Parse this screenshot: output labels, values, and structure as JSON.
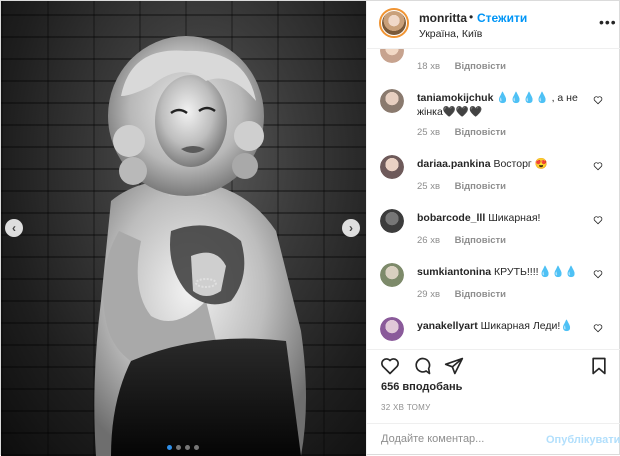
{
  "owner": {
    "username": "monritta",
    "separator": "•",
    "follow_label": "Стежити",
    "location": "Україна, Київ",
    "avatar_icon": "user-avatar-icon",
    "more_icon": "more-options-icon"
  },
  "photo": {
    "slides_total": 4,
    "slide_active": 1,
    "prev_icon": "chevron-left-icon",
    "next_icon": "chevron-right-icon"
  },
  "comments": [
    {
      "username": "",
      "text": "",
      "time": "18 хв",
      "reply_label": "Відповісти",
      "avatar_color": "#c7a38f"
    },
    {
      "username": "taniamokijchuk",
      "text": "💧💧💧💧 , а не жінка🖤🖤🖤",
      "time": "25 хв",
      "reply_label": "Відповісти",
      "avatar_color": "#8a7a6e"
    },
    {
      "username": "dariaa.pankina",
      "text": "Восторг 😍",
      "time": "25 хв",
      "reply_label": "Відповісти",
      "avatar_color": "#6e5a5a"
    },
    {
      "username": "bobarcode_lll",
      "text": "Шикарная!",
      "time": "26 хв",
      "reply_label": "Відповісти",
      "avatar_color": "#3c3c3c"
    },
    {
      "username": "sumkiantonina",
      "text": "КРУТЬ!!!!💧💧💧",
      "time": "29 хв",
      "reply_label": "Відповісти",
      "avatar_color": "#7d8a6a"
    },
    {
      "username": "yanakellyart",
      "text": "Шикарная Леди!💧",
      "time": "",
      "reply_label": "",
      "avatar_color": "#8a5a9a"
    }
  ],
  "actions": {
    "like_icon": "heart-icon",
    "comment_icon": "comment-bubble-icon",
    "share_icon": "paper-plane-icon",
    "save_icon": "bookmark-icon"
  },
  "likes_text": "656 вподобань",
  "time_ago": "32 хв тому",
  "add_comment": {
    "placeholder": "Додайте коментар...",
    "post_label": "Опублікувати"
  },
  "colors": {
    "accent": "#0095f6",
    "post_disabled": "#b2dffc",
    "muted": "#8e8e8e",
    "border": "#efefef"
  }
}
